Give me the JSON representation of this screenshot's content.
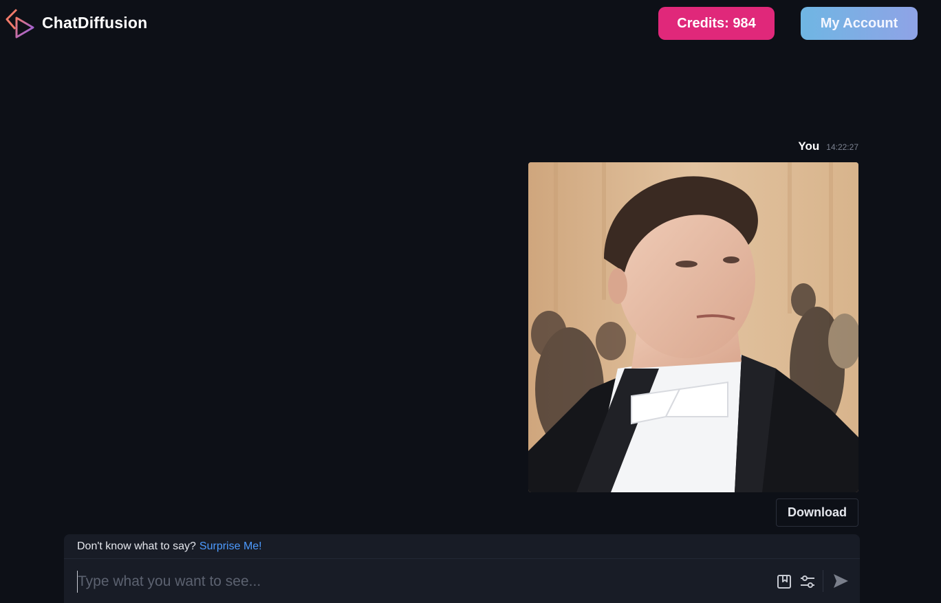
{
  "app": {
    "brand": "ChatDiffusion",
    "brand_colors": {
      "logo_top": "#f07a6a",
      "logo_bottom": "#8c5cf0"
    }
  },
  "header": {
    "credits_label": "Credits: 984",
    "account_label": "My Account",
    "credits_color": "#e0287a"
  },
  "message": {
    "author": "You",
    "time": "14:22:27",
    "image_icon": "generated-image-portrait",
    "download_label": "Download"
  },
  "composer": {
    "hint": "Don't know what to say?",
    "surprise_label": "Surprise Me!",
    "placeholder": "Type what you want to see...",
    "icons": [
      "bookmark-icon",
      "sliders-icon",
      "send-icon"
    ]
  }
}
